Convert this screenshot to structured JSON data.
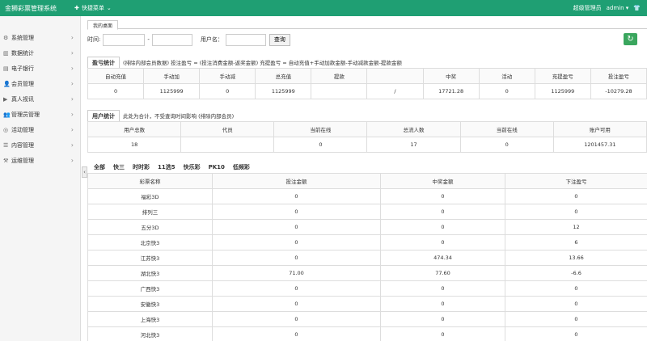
{
  "app": {
    "brand": "金狮彩票管理系统",
    "quick_menu": "快捷菜单",
    "role": "超级管理员",
    "user": "admin"
  },
  "sidebar": {
    "items": [
      {
        "label": "系统管理"
      },
      {
        "label": "数据统计"
      },
      {
        "label": "电子银行"
      },
      {
        "label": "会员管理"
      },
      {
        "label": "真人视讯"
      },
      {
        "label": "管理员管理"
      },
      {
        "label": "活动管理"
      },
      {
        "label": "内容管理"
      },
      {
        "label": "运维管理"
      }
    ]
  },
  "tabs": {
    "desk": "我的桌面"
  },
  "filter": {
    "time_label": "时间:",
    "sep": "-",
    "username_label": "用户名：",
    "search_btn": "查询"
  },
  "profit": {
    "title": "盈亏统计",
    "note": "(排除内部会员数据)  投注盈亏 = (投注消费金额-返奖金额)    充提盈亏 = 自动充值+手动加款金额-手动减款金额-提款金额",
    "headers": [
      "自动充值",
      "手动加",
      "手动减",
      "总充值",
      "提款",
      "",
      "中奖",
      "活动",
      "充提盈亏",
      "投注盈亏"
    ],
    "values": [
      "0",
      "1125999",
      "0",
      "1125999",
      "",
      "/",
      "17721.28",
      "0",
      "1125999",
      "-10279.28"
    ]
  },
  "users": {
    "title": "用户统计",
    "note": "此处为合计，不受查询时间影响 (排除内部会员)",
    "headers": [
      "用户总数",
      "代员",
      "当前在线",
      "总流人数",
      "当前在线",
      "账户可用"
    ],
    "values": [
      "18",
      "",
      "0",
      "17",
      "0",
      "1201457.31"
    ]
  },
  "lottery": {
    "tabs": [
      "全部",
      "快三",
      "时时彩",
      "11选5",
      "快乐彩",
      "PK10",
      "低频彩"
    ],
    "headers": [
      "彩票名称",
      "投注金额",
      "中奖金额",
      "下注盈亏"
    ],
    "header_extra": "中奖金额",
    "rows": [
      {
        "name": "福彩3D",
        "bet": "0",
        "win": "0",
        "profit": "0"
      },
      {
        "name": "排列三",
        "bet": "0",
        "win": "0",
        "profit": "0"
      },
      {
        "name": "五分3D",
        "bet": "0",
        "win": "0",
        "profit": "12"
      },
      {
        "name": "北京快3",
        "bet": "0",
        "win": "0",
        "profit": "6"
      },
      {
        "name": "江苏快3",
        "bet": "0",
        "win": "474.34",
        "profit": "13.66"
      },
      {
        "name": "湖北快3",
        "bet": "71.00",
        "win": "77.60",
        "profit": "-6.6"
      },
      {
        "name": "广西快3",
        "bet": "0",
        "win": "0",
        "profit": "0"
      },
      {
        "name": "安徽快3",
        "bet": "0",
        "win": "0",
        "profit": "0"
      },
      {
        "name": "上海快3",
        "bet": "0",
        "win": "0",
        "profit": "0"
      },
      {
        "name": "河北快3",
        "bet": "0",
        "win": "0",
        "profit": "0"
      }
    ]
  }
}
